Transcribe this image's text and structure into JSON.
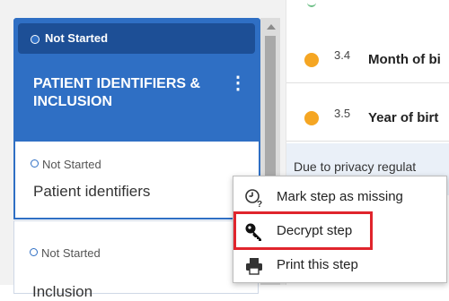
{
  "sidebar": {
    "section": {
      "status": "Not Started",
      "title": "PATIENT IDENTIFIERS & INCLUSION"
    },
    "steps": [
      {
        "status": "Not Started",
        "name": "Patient identifiers"
      },
      {
        "status": "Not Started",
        "name": "Inclusion"
      }
    ]
  },
  "content": {
    "rows": [
      {
        "number": "3.4",
        "label": "Month of bi"
      },
      {
        "number": "3.5",
        "label": "Year of birt"
      }
    ],
    "notice": "Due to privacy regulat"
  },
  "context_menu": {
    "items": [
      {
        "label": "Mark step as missing",
        "icon": "clock-question-icon"
      },
      {
        "label": "Decrypt step",
        "icon": "key-icon"
      },
      {
        "label": "Print this step",
        "icon": "printer-icon"
      }
    ]
  },
  "colors": {
    "section_blue": "#2f6fc4",
    "status_dark_blue": "#1d4f96",
    "pending_orange": "#f5a623",
    "highlight_red": "#e0242c"
  }
}
